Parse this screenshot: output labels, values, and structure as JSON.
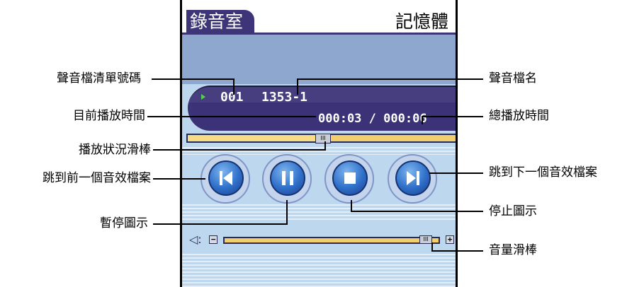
{
  "app": {
    "title": "錄音室",
    "storage_label": "記憶體"
  },
  "player": {
    "track_number": "001",
    "track_name": "1353-1",
    "elapsed_time": "000:03",
    "time_separator": "/",
    "total_time": "000:06",
    "progress_fraction": 0.5,
    "volume_fraction": 0.97,
    "thumb_glyph": "III",
    "volume_minus_glyph": "−",
    "volume_plus_glyph": "+",
    "volume_icon_glyph": "◁:"
  },
  "controls": [
    {
      "name": "previous-track-button",
      "icon": "skip-back-icon"
    },
    {
      "name": "pause-button",
      "icon": "pause-icon"
    },
    {
      "name": "stop-button",
      "icon": "stop-icon"
    },
    {
      "name": "next-track-button",
      "icon": "skip-forward-icon"
    }
  ],
  "callouts": {
    "track_list_number": "聲音檔清單號碼",
    "track_file_name": "聲音檔名",
    "current_play_time": "目前播放時間",
    "total_play_time": "總播放時間",
    "playback_slider": "播放狀況滑棒",
    "jump_previous": "跳到前一個音效檔案",
    "jump_next": "跳到下一個音效檔案",
    "pause_icon": "暫停圖示",
    "stop_icon": "停止圖示",
    "volume_slider": "音量滑棒"
  },
  "colors": {
    "title_bar": "#3d3577",
    "info_panel": "#3c3277",
    "screen_background": "#bcd7ee",
    "slider_track": "#f2cf6e",
    "button_blue": "#2f6fc9"
  }
}
